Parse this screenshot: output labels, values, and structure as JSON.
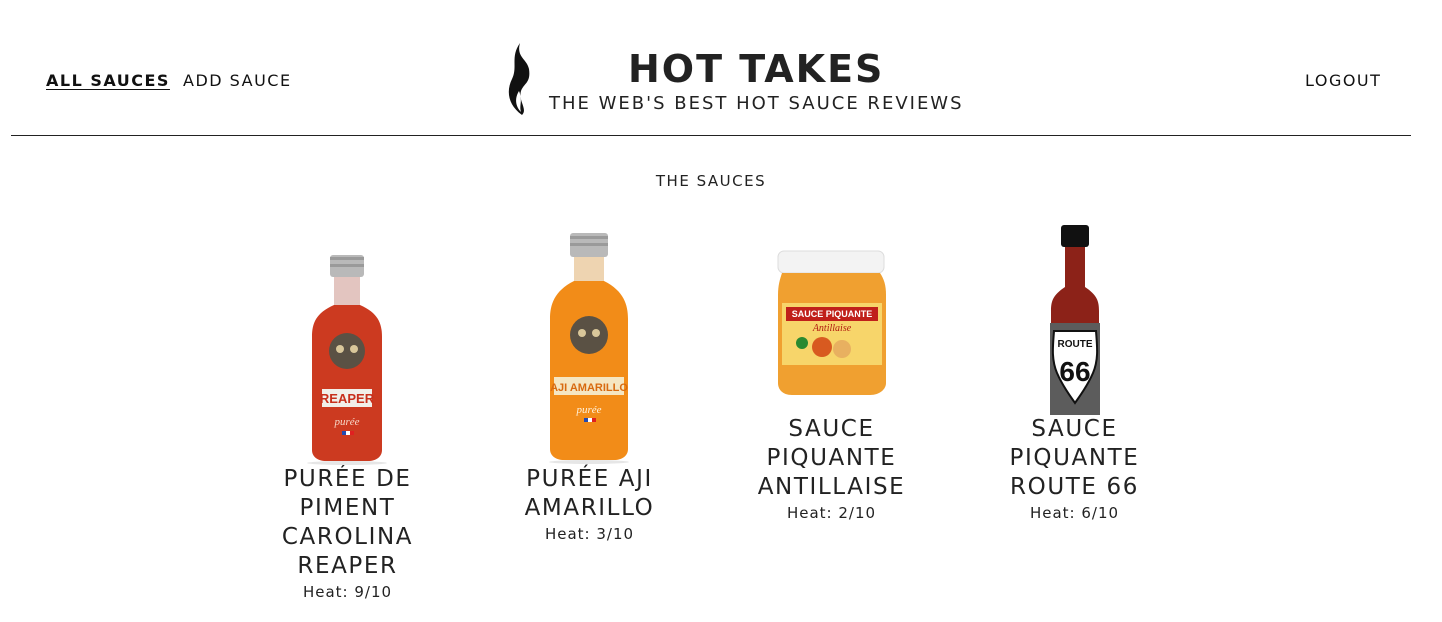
{
  "nav": {
    "all_sauces": "ALL SAUCES",
    "add_sauce": "ADD SAUCE",
    "logout": "LOGOUT"
  },
  "brand": {
    "title": "HOT TAKES",
    "subtitle": "THE WEB'S BEST HOT SAUCE REVIEWS",
    "logo_icon": "flame-icon"
  },
  "section": {
    "title": "THE SAUCES"
  },
  "sauces": [
    {
      "name": "PURÉE DE PIMENT CAROLINA REAPER",
      "heat": "Heat: 9/10",
      "label": "REAPER",
      "sub": "purée",
      "color": "#c8301c"
    },
    {
      "name": "PURÉE AJI AMARILLO",
      "heat": "Heat: 3/10",
      "label": "AJI AMARILLO",
      "sub": "purée",
      "color": "#f08a16"
    },
    {
      "name": "SAUCE PIQUANTE ANTILLAISE",
      "heat": "Heat: 2/10",
      "label": "SAUCE PIQUANTE",
      "sub": "Antillaise",
      "color": "#f0a030"
    },
    {
      "name": "SAUCE PIQUANTE ROUTE 66",
      "heat": "Heat: 6/10",
      "label": "ROUTE",
      "sub": "66",
      "color": "#8c2218"
    }
  ]
}
